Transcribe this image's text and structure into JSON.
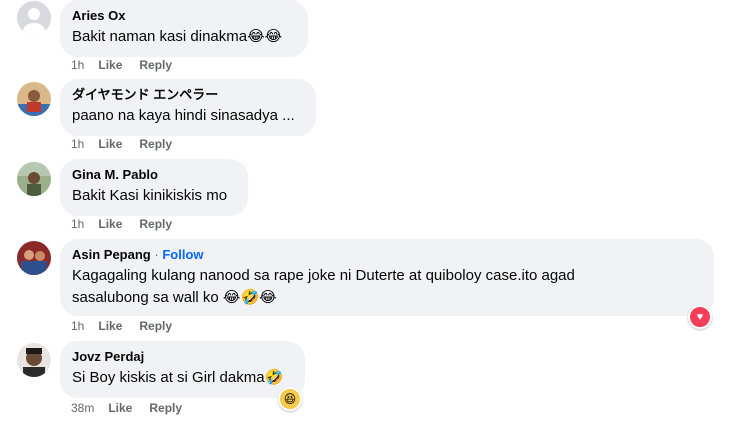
{
  "comments": [
    {
      "name": "Aries Ox",
      "text": "Bakit naman kasi dinakma😂😂",
      "time": "1h",
      "like": "Like",
      "reply": "Reply",
      "avatar_color": "#d0d3d8"
    },
    {
      "name": "ダイヤモンド エンペラー",
      "text": "paano na kaya hindi sinasadya ...",
      "time": "1h",
      "like": "Like",
      "reply": "Reply",
      "avatar_color": "#c9a26c"
    },
    {
      "name": "Gina M. Pablo",
      "text": "Bakit Kasi kinikiskis mo",
      "time": "1h",
      "like": "Like",
      "reply": "Reply",
      "avatar_color": "#7a8c6a"
    },
    {
      "name": "Asin Pepang",
      "separator": "·",
      "follow": "Follow",
      "text_line1": "Kagagaling kulang nanood sa rape joke ni Duterte at quiboloy case.ito agad",
      "text_line2": "sasalubong sa wall ko 😂🤣😂",
      "time": "1h",
      "like": "Like",
      "reply": "Reply",
      "reaction": "heart",
      "avatar_color": "#b33a3a"
    },
    {
      "name": "Jovz Perdaj",
      "text": "Si Boy kiskis at si Girl dakma🤣",
      "time": "38m",
      "like": "Like",
      "reply": "Reply",
      "reaction": "haha",
      "avatar_color": "#5a4a3e"
    }
  ],
  "reactions": {
    "heart_glyph": "♥",
    "haha_glyph": "😆"
  },
  "colors": {
    "bubble": "#f0f2f5",
    "meta": "#65676b",
    "follow": "#0866ff",
    "heart": "#f33e58"
  }
}
